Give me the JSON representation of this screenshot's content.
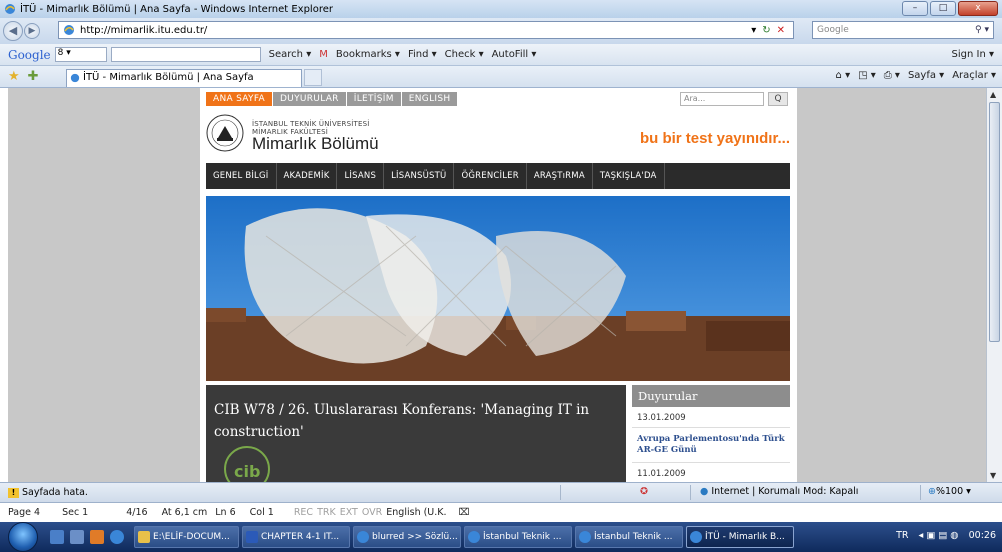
{
  "window": {
    "title": "İTÜ - Mimarlık Bölümü | Ana Sayfa - Windows Internet Explorer",
    "btn_min": "–",
    "btn_max": "□",
    "btn_close": "x"
  },
  "address_bar": {
    "url": "http://mimarlik.itu.edu.tr/",
    "search_placeholder": "Google",
    "refresh": "↻",
    "stop": "✕"
  },
  "google_toolbar": {
    "logo": "Google",
    "selector": "8 ▾",
    "items": [
      "Search ▾",
      "Bookmarks ▾",
      "Find ▾",
      "Check ▾",
      "AutoFill ▾"
    ],
    "sign_in": "Sign In ▾"
  },
  "favorites_bar": {
    "tab_title": "İTÜ - Mimarlık Bölümü | Ana Sayfa",
    "tools": [
      "Sayfa ▾",
      "Araçlar ▾"
    ]
  },
  "site": {
    "top_nav": [
      "ANA SAYFA",
      "DUYURULAR",
      "İLETİŞİM",
      "ENGLISH"
    ],
    "search_placeholder": "Ara...",
    "search_btn": "Q",
    "uni_line1": "İSTANBUL TEKNİK ÜNİVERSİTESİ",
    "uni_line2": "MİMARLIK FAKÜLTESİ",
    "dept": "Mimarlık Bölümü",
    "test_msg": "bu bir test yayınıdır...",
    "main_nav": [
      "GENEL BİLGİ",
      "AKADEMİK",
      "LİSANS",
      "LİSANSÜSTÜ",
      "ÖĞRENCİLER",
      "ARAŞTıRMA",
      "TAŞKIŞLA'DA"
    ],
    "article_title": "CIB W78 / 26. Uluslararası Konferans: 'Managing IT in construction'",
    "announcements": {
      "title": "Duyurular",
      "items": [
        {
          "date": "13.01.2009",
          "text": "Avrupa Parlementosu'nda Türk AR-GE Günü"
        },
        {
          "date": "11.01.2009",
          "text": ""
        }
      ]
    }
  },
  "status_bar": {
    "warning": "Sayfada hata.",
    "zone": "Internet | Korumalı Mod: Kapalı",
    "zoom": "%100 ▾"
  },
  "word_status": {
    "page": "Page 4",
    "sec": "Sec 1",
    "pages": "4/16",
    "at": "At 6,1 cm",
    "ln": "Ln 6",
    "col": "Col 1",
    "modes": [
      "REC",
      "TRK",
      "EXT",
      "OVR"
    ],
    "lang": "English (U.K."
  },
  "taskbar": {
    "tasks": [
      "E:\\ELİF-DOCUM...",
      "CHAPTER 4-1 IT...",
      "blurred >> Sözlü...",
      "İstanbul Teknik ...",
      "İstanbul Teknik ...",
      "İTÜ - Mimarlık B..."
    ],
    "lang": "TR",
    "clock": "00:26"
  },
  "colors": {
    "accent_orange": "#f07318",
    "nav_dark": "#2b2b2b",
    "link_blue": "#2d4f8e"
  }
}
